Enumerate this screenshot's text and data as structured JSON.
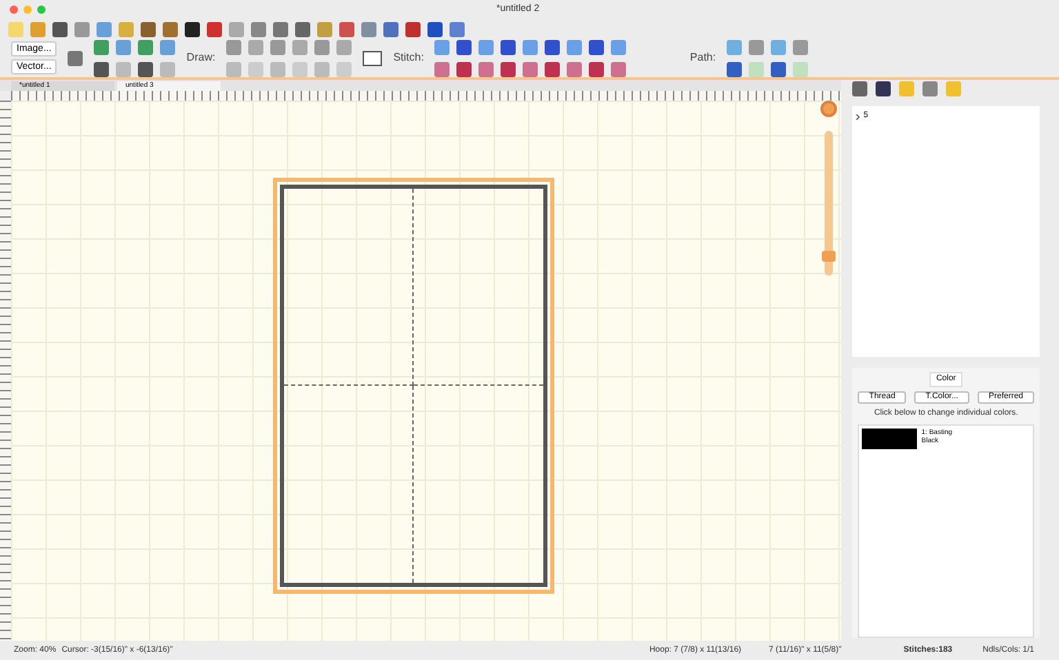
{
  "window": {
    "title": "*untitled 2"
  },
  "toolbar": {
    "image_button": "Image...",
    "vector_button": "Vector...",
    "draw_label": "Draw:",
    "stitch_label": "Stitch:",
    "path_label": "Path:"
  },
  "tabs": [
    {
      "label": "*untitled 1",
      "selected": false
    },
    {
      "label": "untitled 3",
      "selected": true
    }
  ],
  "zoom_slider": {
    "level": 0.1
  },
  "object_list": {
    "items": [
      {
        "label": "5",
        "expanded": false
      }
    ]
  },
  "color_panel": {
    "title": "Color",
    "buttons": [
      "Thread",
      "T.Color...",
      "Preferred"
    ],
    "hint": "Click below to change individual colors.",
    "colors": [
      {
        "name": "1: Basting",
        "thread": "Black",
        "color": "#000000"
      }
    ]
  },
  "status_bar": {
    "zoom": "Zoom: 40%",
    "cursor": "Cursor: -3(15/16)\" x -6(13/16)\"",
    "hoop": "Hoop: 7 (7/8) x 11(13/16)",
    "size": "7 (11/16)\" x 11(5/8)\"",
    "stitches": "Stitches:183",
    "ndls": "Ndls/Cols: 1/1"
  }
}
